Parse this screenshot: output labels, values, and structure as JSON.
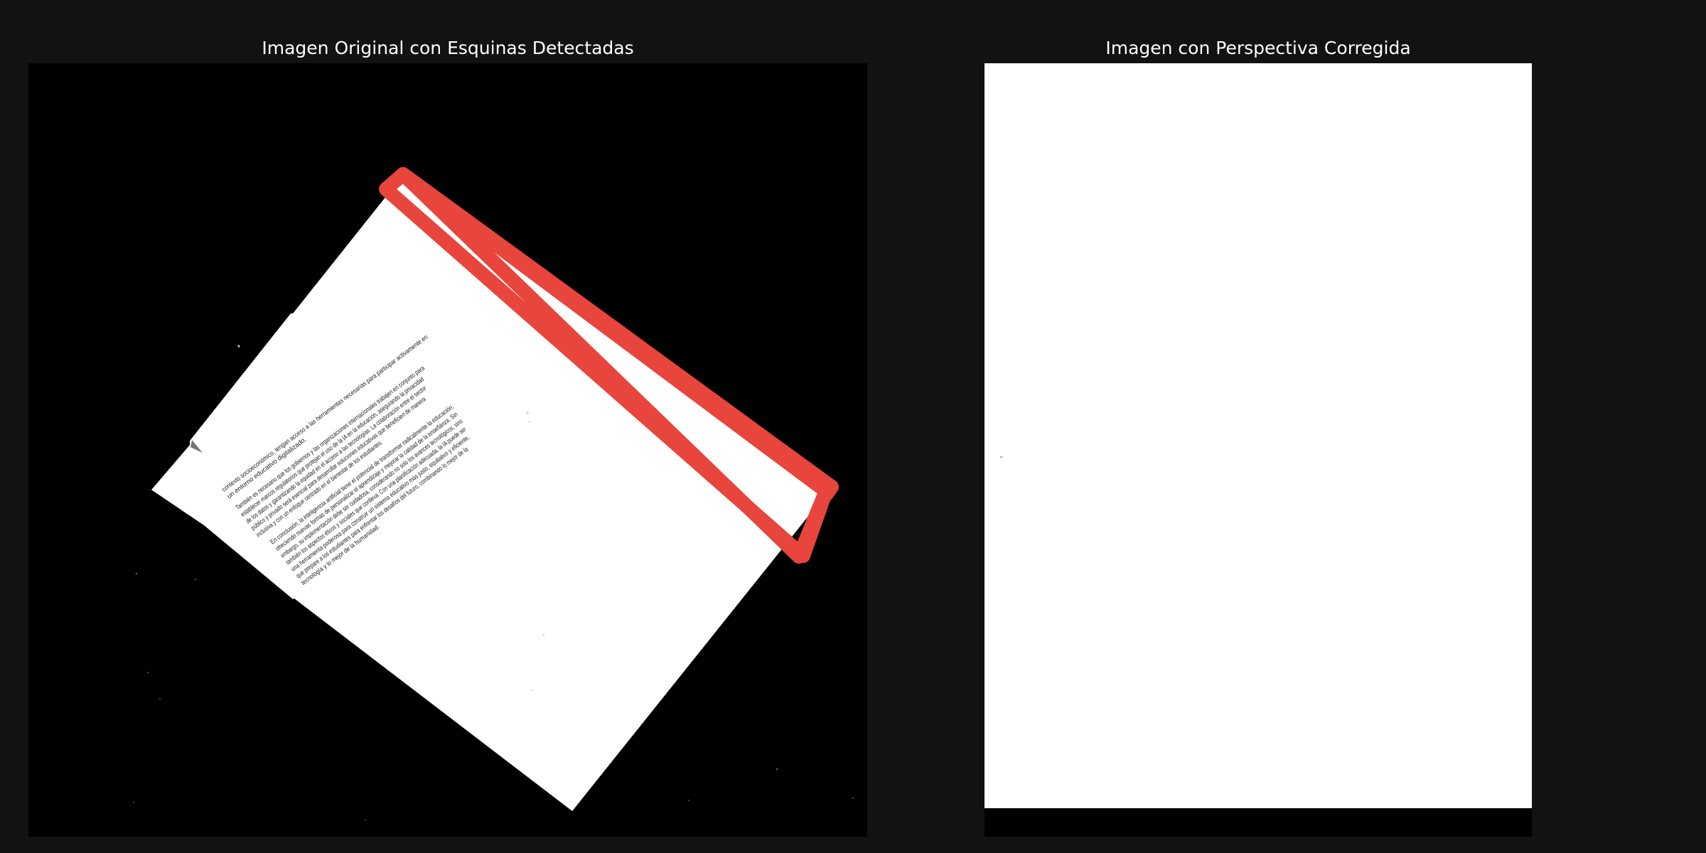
{
  "figure": {
    "left_title": "Imagen Original con Esquinas Detectadas",
    "right_title": "Imagen con Perspectiva Corregida"
  },
  "colors": {
    "background": "#121212",
    "panel": "#000000",
    "paper": "#ffffff",
    "detection_outline": "#e8453c",
    "title_text": "#ffffff"
  },
  "document_text": {
    "lines": [
      "contexto socioeconómico, tengan acceso a las herramientas necesarias para participar activamente en",
      "un entorno educativo digitalizado.",
      "También es necesario que los gobiernos y las organizaciones internacionales trabajen en conjunto para",
      "establecer marcos regulatorios que protejan el uso de la IA en la educación, asegurando la privacidad",
      "de los datos y garantizando la equidad en el acceso a las tecnologías. La colaboración entre el sector",
      "público y privado será esencial para desarrollar soluciones educativas que beneficien de manera",
      "inclusiva y con un enfoque centrado en el bienestar de los estudiantes.",
      "En conclusión, la inteligencia artificial tiene el potencial de transformar radicalmente la educación,",
      "ofreciendo nuevas formas de personalizar el aprendizaje y mejorar la calidad de la enseñanza. Sin",
      "embargo, su implementación debe ser cuidadosa, considerando no solo los avances tecnológicos, sino",
      "también los aspectos éticos y sociales que conlleva. Con una planificación adecuada, la IA puede ser",
      "una herramienta poderosa para construir un sistema educativo más justo, equitativo y eficiente,",
      "que prepare a los estudiantes para enfrentar los desafíos del futuro, combinando lo mejor de la",
      "tecnología y lo mejor de la humanidad."
    ]
  }
}
